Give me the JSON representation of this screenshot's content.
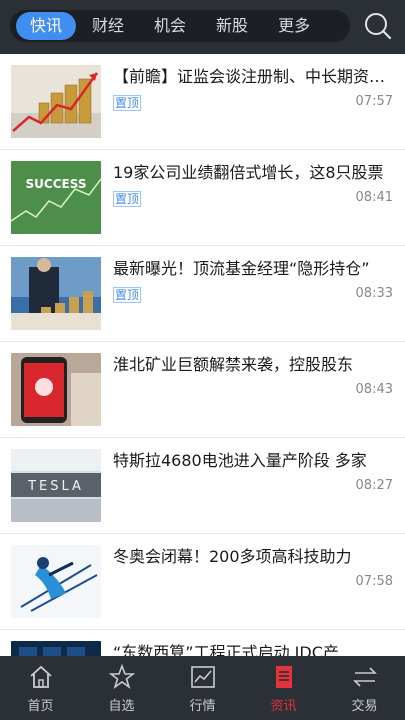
{
  "header": {
    "tabs": [
      {
        "label": "快讯",
        "active": true
      },
      {
        "label": "财经",
        "active": false
      },
      {
        "label": "机会",
        "active": false
      },
      {
        "label": "新股",
        "active": false
      },
      {
        "label": "更多",
        "active": false
      }
    ],
    "search_icon": "search-icon"
  },
  "news": [
    {
      "title": "【前瞻】证监会谈注册制、中长期资金入市",
      "tag": "置顶",
      "time": "07:57",
      "thumb": "coins-chart"
    },
    {
      "title": "19家公司业绩翻倍式增长，这8只股票",
      "tag": "置顶",
      "time": "08:41",
      "thumb": "success-chart"
    },
    {
      "title": "最新曝光！顶流基金经理“隐形持仓”",
      "tag": "置顶",
      "time": "08:33",
      "thumb": "businessman-coins"
    },
    {
      "title": "淮北矿业巨额解禁来袭，控股股东",
      "tag": "",
      "time": "08:43",
      "thumb": "red-phone"
    },
    {
      "title": "特斯拉4680电池进入量产阶段 多家",
      "tag": "",
      "time": "08:27",
      "thumb": "tesla-store"
    },
    {
      "title": "冬奥会闭幕！200多项高科技助力",
      "tag": "",
      "time": "07:58",
      "thumb": "skier"
    },
    {
      "title": "“东数西算”工程正式启动 IDC产",
      "tag": "",
      "time": "",
      "thumb": "datacenter"
    }
  ],
  "thumb_labels": {
    "success": "SUCCESS",
    "tesla": "TESLA"
  },
  "bottom_nav": [
    {
      "label": "首页",
      "icon": "home-icon",
      "active": false
    },
    {
      "label": "自选",
      "icon": "star-icon",
      "active": false
    },
    {
      "label": "行情",
      "icon": "chart-icon",
      "active": false
    },
    {
      "label": "资讯",
      "icon": "news-icon",
      "active": true
    },
    {
      "label": "交易",
      "icon": "exchange-icon",
      "active": false
    }
  ],
  "colors": {
    "accent": "#3f8ef0",
    "active_nav": "#e2333a",
    "bar_bg": "#2b2f36"
  }
}
